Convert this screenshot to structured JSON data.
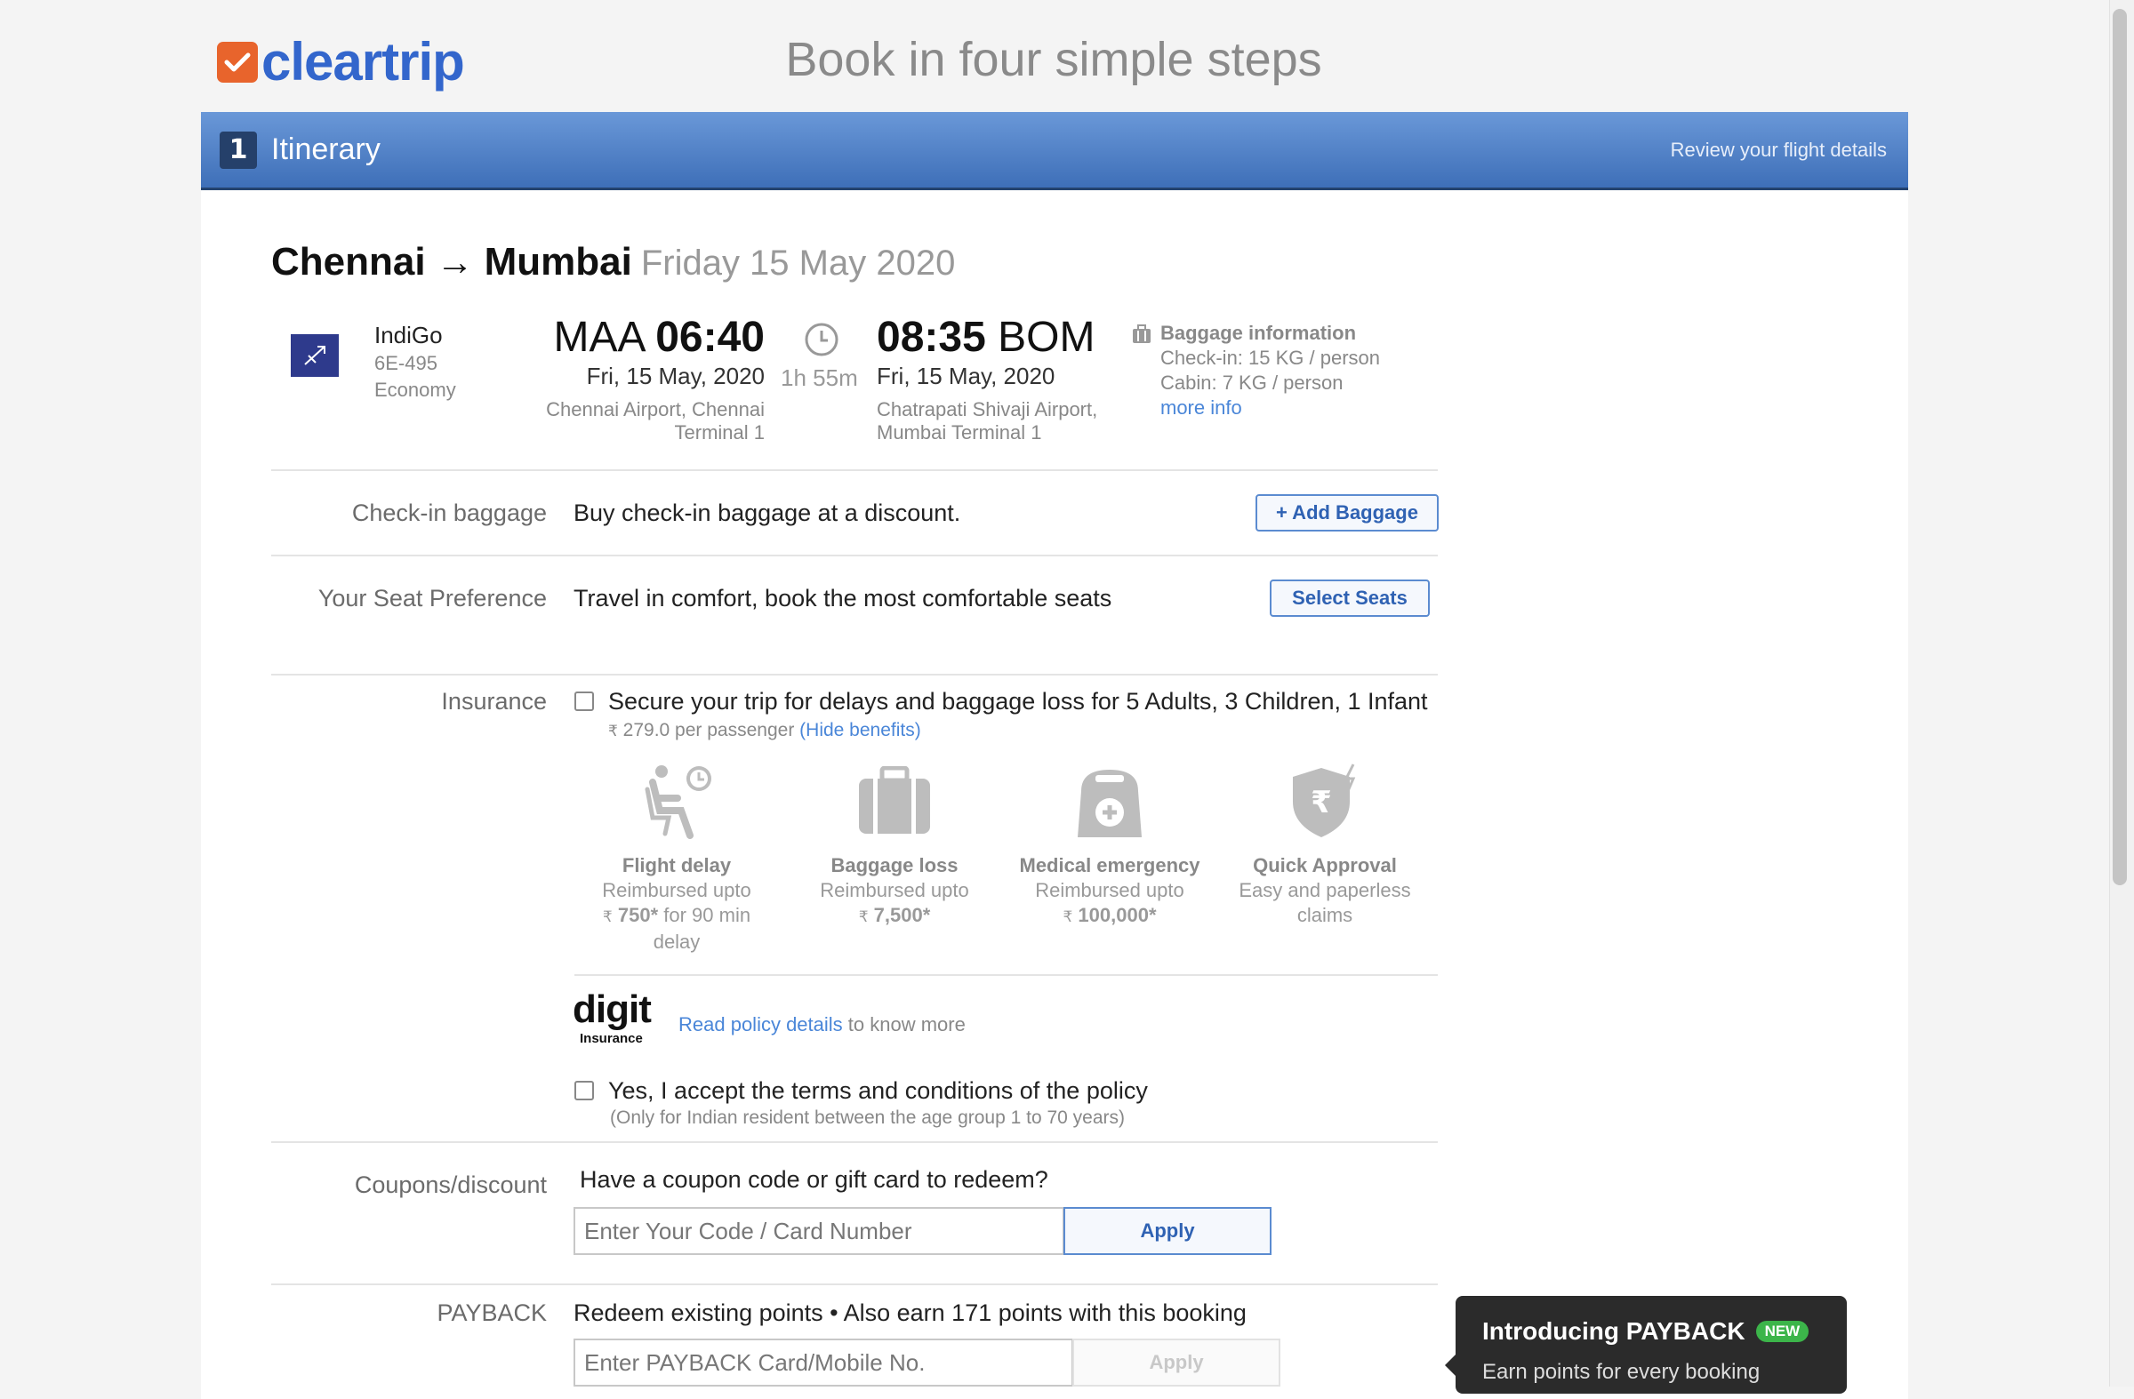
{
  "brand": {
    "name": "cleartrip"
  },
  "headline": "Book in four simple steps",
  "step": {
    "number": "1",
    "title": "Itinerary",
    "hint": "Review your flight details"
  },
  "route": {
    "from": "Chennai",
    "to": "Mumbai",
    "date": "Friday 15 May 2020"
  },
  "flight": {
    "airline": "IndiGo",
    "code": "6E-495",
    "cabin": "Economy",
    "depart": {
      "code": "MAA",
      "time": "06:40",
      "date": "Fri, 15 May, 2020",
      "airport_line1": "Chennai Airport, Chennai",
      "airport_line2": "Terminal 1"
    },
    "duration": "1h 55m",
    "arrive": {
      "code": "BOM",
      "time": "08:35",
      "date": "Fri, 15 May, 2020",
      "airport_line1": "Chatrapati Shivaji Airport,",
      "airport_line2": "Mumbai Terminal 1"
    },
    "baggage": {
      "title": "Baggage information",
      "checkin": "Check-in: 15 KG / person",
      "cabin": "Cabin: 7 KG / person",
      "more": "more info"
    }
  },
  "checkin_baggage": {
    "label": "Check-in baggage",
    "text": "Buy check-in baggage at a discount.",
    "button": "+ Add Baggage"
  },
  "seat": {
    "label": "Your Seat Preference",
    "text": "Travel in comfort, book the most comfortable seats",
    "button": "Select Seats"
  },
  "insurance": {
    "label": "Insurance",
    "text": "Secure your trip for delays and baggage loss for 5 Adults, 3 Children, 1 Infant",
    "currency": "₹",
    "price": "279.0 per passenger",
    "toggle": "(Hide benefits)",
    "benefits": [
      {
        "icon": "flight-delay-icon",
        "title": "Flight delay",
        "line1": "Reimbursed upto",
        "amount": "750*",
        "suffix": " for 90 min",
        "line3": "delay"
      },
      {
        "icon": "baggage-loss-icon",
        "title": "Baggage loss",
        "line1": "Reimbursed upto",
        "amount": "7,500*",
        "suffix": "",
        "line3": ""
      },
      {
        "icon": "medical-emergency-icon",
        "title": "Medical emergency",
        "line1": "Reimbursed upto",
        "amount": "100,000*",
        "suffix": "",
        "line3": ""
      },
      {
        "icon": "quick-approval-icon",
        "title": "Quick Approval",
        "line1": "Easy and paperless",
        "amount": "",
        "suffix": "claims",
        "line3": ""
      }
    ],
    "provider": {
      "name": "digit",
      "sub": "Insurance"
    },
    "policy_link": "Read policy details",
    "policy_suffix": " to know more",
    "terms": "Yes, I accept the terms and conditions of the policy",
    "terms_note": "(Only for Indian resident between the age group 1 to 70 years)"
  },
  "coupon": {
    "label": "Coupons/discount",
    "prompt": "Have a coupon code or gift card to redeem?",
    "placeholder": "Enter Your Code / Card Number",
    "button": "Apply"
  },
  "payback": {
    "label": "PAYBACK",
    "text": "Redeem existing points • Also earn 171 points with this booking",
    "placeholder": "Enter PAYBACK Card/Mobile No.",
    "button": "Apply"
  },
  "tooltip": {
    "title": "Introducing PAYBACK",
    "badge": "NEW",
    "text": "Earn points for every booking"
  },
  "colors": {
    "brand_orange": "#e8642c",
    "brand_blue": "#3366cc",
    "step_bar": "#4f80c6",
    "link": "#4a86d8",
    "badge_green": "#3cb54a"
  }
}
